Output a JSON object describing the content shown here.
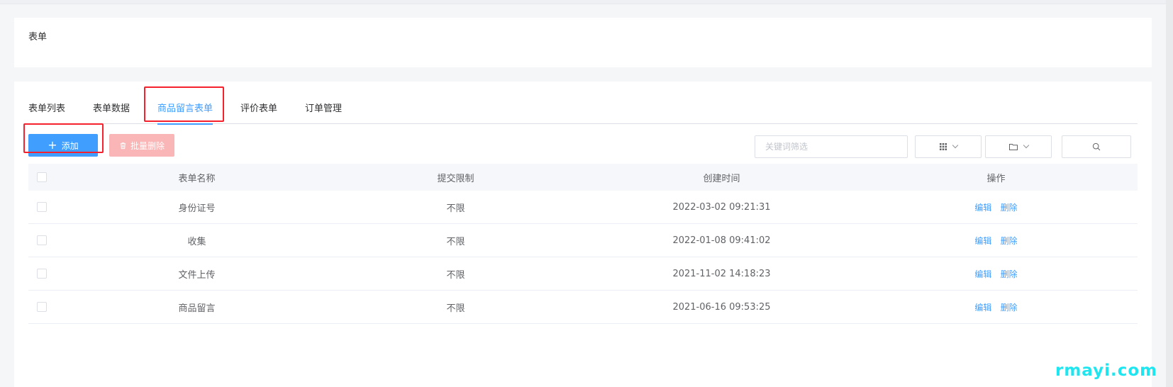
{
  "page": {
    "title": "表单"
  },
  "tabs": [
    {
      "label": "表单列表",
      "active": false
    },
    {
      "label": "表单数据",
      "active": false
    },
    {
      "label": "商品留言表单",
      "active": true
    },
    {
      "label": "评价表单",
      "active": false
    },
    {
      "label": "订单管理",
      "active": false
    }
  ],
  "toolbar": {
    "add_label": "添加",
    "batch_delete_label": "批量删除",
    "search_placeholder": "关键词筛选"
  },
  "table": {
    "columns": [
      "表单名称",
      "提交限制",
      "创建时间",
      "操作"
    ],
    "rows": [
      {
        "name": "身份证号",
        "limit": "不限",
        "created": "2022-03-02 09:21:31"
      },
      {
        "name": "收集",
        "limit": "不限",
        "created": "2022-01-08 09:41:02"
      },
      {
        "name": "文件上传",
        "limit": "不限",
        "created": "2021-11-02 14:18:23"
      },
      {
        "name": "商品留言",
        "limit": "不限",
        "created": "2021-06-16 09:53:25"
      }
    ],
    "actions": {
      "edit": "编辑",
      "delete": "删除"
    }
  },
  "colors": {
    "primary": "#409eff",
    "danger_light": "#fab6b6",
    "highlight": "#f5222d",
    "watermark": "#1ee6f0"
  },
  "icons": [
    "plus-icon",
    "trash-icon",
    "grid-icon",
    "folder-icon",
    "chevron-down-icon",
    "search-icon"
  ],
  "watermark": "rmayi.com"
}
